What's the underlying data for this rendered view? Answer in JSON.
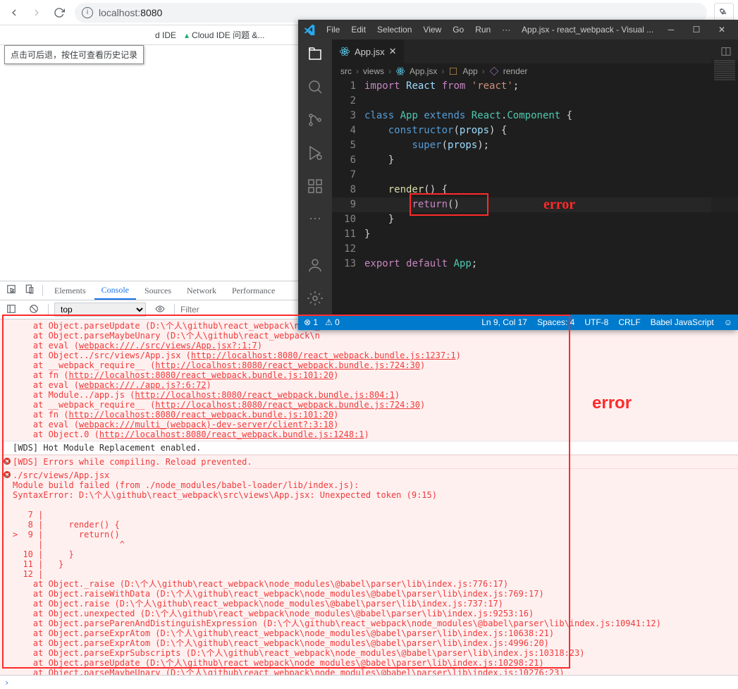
{
  "browser": {
    "url_host": "localhost:",
    "url_port": "8080",
    "back_tooltip": "点击可后退，按住可查看历史记录",
    "bookmarks": [
      "d IDE",
      "Cloud IDE 问题 &..."
    ]
  },
  "annotations": {
    "error_label_small": "error",
    "error_label_big": "error"
  },
  "vscode": {
    "menu": [
      "File",
      "Edit",
      "Selection",
      "View",
      "Go",
      "Run",
      "···"
    ],
    "window_title": "App.jsx - react_webpack - Visual ...",
    "tab": "App.jsx",
    "breadcrumb": [
      "src",
      "views",
      "App.jsx",
      "App",
      "render"
    ],
    "code": {
      "lines": [
        {
          "n": 1,
          "html": "<span class='tok-kw2'>import</span> <span class='tok-var'>React</span> <span class='tok-kw2'>from</span> <span class='tok-str'>'react'</span>;"
        },
        {
          "n": 2,
          "html": ""
        },
        {
          "n": 3,
          "html": "<span class='tok-kw'>class</span> <span class='tok-cls'>App</span> <span class='tok-kw'>extends</span> <span class='tok-cls'>React</span>.<span class='tok-cls'>Component</span> {"
        },
        {
          "n": 4,
          "html": "    <span class='tok-kw'>constructor</span>(<span class='tok-var'>props</span>) {"
        },
        {
          "n": 5,
          "html": "        <span class='tok-kw'>super</span>(<span class='tok-var'>props</span>);"
        },
        {
          "n": 6,
          "html": "    }"
        },
        {
          "n": 7,
          "html": ""
        },
        {
          "n": 8,
          "html": "    <span class='tok-fn'>render</span>() {"
        },
        {
          "n": 9,
          "html": "        <span class='tok-kw2'>return</span>()"
        },
        {
          "n": 10,
          "html": "    }"
        },
        {
          "n": 11,
          "html": "}"
        },
        {
          "n": 12,
          "html": ""
        },
        {
          "n": 13,
          "html": "<span class='tok-kw2'>export</span> <span class='tok-kw2'>default</span> <span class='tok-cls'>App</span>;"
        }
      ],
      "highlight_line_index": 8
    },
    "status": {
      "errors": "⊗ 1",
      "warnings": "⚠ 0",
      "position": "Ln 9, Col 17",
      "spaces": "Spaces: 4",
      "encoding": "UTF-8",
      "eol": "CRLF",
      "lang": "Babel JavaScript"
    }
  },
  "devtools": {
    "tabs": [
      "Elements",
      "Console",
      "Sources",
      "Network",
      "Performance"
    ],
    "active_tab": "Console",
    "context": "top",
    "filter_placeholder": "Filter",
    "stack_top": [
      "at Object.parseUpdate (D:\\个人\\github\\react_webpack\\node_",
      "at Object.parseMaybeUnary (D:\\个人\\github\\react_webpack\\n"
    ],
    "stack_links": [
      {
        "pre": "at eval (",
        "link": "webpack:///./src/views/App.jsx?:1:7",
        "post": ")"
      },
      {
        "pre": "at Object../src/views/App.jsx (",
        "link": "http://localhost:8080/react_webpack.bundle.js:1237:1",
        "post": ")"
      },
      {
        "pre": "at __webpack_require__ (",
        "link": "http://localhost:8080/react_webpack.bundle.js:724:30",
        "post": ")"
      },
      {
        "pre": "at fn (",
        "link": "http://localhost:8080/react_webpack.bundle.js:101:20",
        "post": ")"
      },
      {
        "pre": "at eval (",
        "link": "webpack:///./app.js?:6:72",
        "post": ")"
      },
      {
        "pre": "at Module../app.js (",
        "link": "http://localhost:8080/react_webpack.bundle.js:804:1",
        "post": ")"
      },
      {
        "pre": "at __webpack_require__ (",
        "link": "http://localhost:8080/react_webpack.bundle.js:724:30",
        "post": ")"
      },
      {
        "pre": "at fn (",
        "link": "http://localhost:8080/react_webpack.bundle.js:101:20",
        "post": ")"
      },
      {
        "pre": "at eval (",
        "link": "webpack:///multi_(webpack)-dev-server/client?:3:18",
        "post": ")"
      },
      {
        "pre": "at Object.0 (",
        "link": "http://localhost:8080/react_webpack.bundle.js:1248:1",
        "post": ")"
      }
    ],
    "hmr_line": "[WDS] Hot Module Replacement enabled.",
    "compile_err": "[WDS] Errors while compiling. Reload prevented.",
    "module_header": "./src/views/App.jsx",
    "module_fail": "Module build failed (from ./node_modules/babel-loader/lib/index.js):",
    "syntax_error": "SyntaxError: D:\\个人\\github\\react_webpack\\src\\views\\App.jsx: Unexpected token (9:15)",
    "code_frame": [
      "   7 | ",
      "   8 |     render() {",
      ">  9 |       return()",
      "     |               ^",
      "  10 |     }",
      "  11 |   }",
      "  12 | "
    ],
    "stack_bottom": [
      "at Object._raise (D:\\个人\\github\\react_webpack\\node_modules\\@babel\\parser\\lib\\index.js:776:17)",
      "at Object.raiseWithData (D:\\个人\\github\\react_webpack\\node_modules\\@babel\\parser\\lib\\index.js:769:17)",
      "at Object.raise (D:\\个人\\github\\react_webpack\\node_modules\\@babel\\parser\\lib\\index.js:737:17)",
      "at Object.unexpected (D:\\个人\\github\\react_webpack\\node_modules\\@babel\\parser\\lib\\index.js:9253:16)",
      "at Object.parseParenAndDistinguishExpression (D:\\个人\\github\\react_webpack\\node_modules\\@babel\\parser\\lib\\index.js:10941:12)",
      "at Object.parseExprAtom (D:\\个人\\github\\react_webpack\\node_modules\\@babel\\parser\\lib\\index.js:10638:21)",
      "at Object.parseExprAtom (D:\\个人\\github\\react_webpack\\node_modules\\@babel\\parser\\lib\\index.js:4996:20)",
      "at Object.parseExprSubscripts (D:\\个人\\github\\react_webpack\\node_modules\\@babel\\parser\\lib\\index.js:10318:23)",
      "at Object.parseUpdate (D:\\个人\\github\\react_webpack\\node_modules\\@babel\\parser\\lib\\index.js:10298:21)",
      "at Object.parseMaybeUnary (D:\\个人\\github\\react_webpack\\node_modules\\@babel\\parser\\lib\\index.js:10276:23)"
    ]
  }
}
